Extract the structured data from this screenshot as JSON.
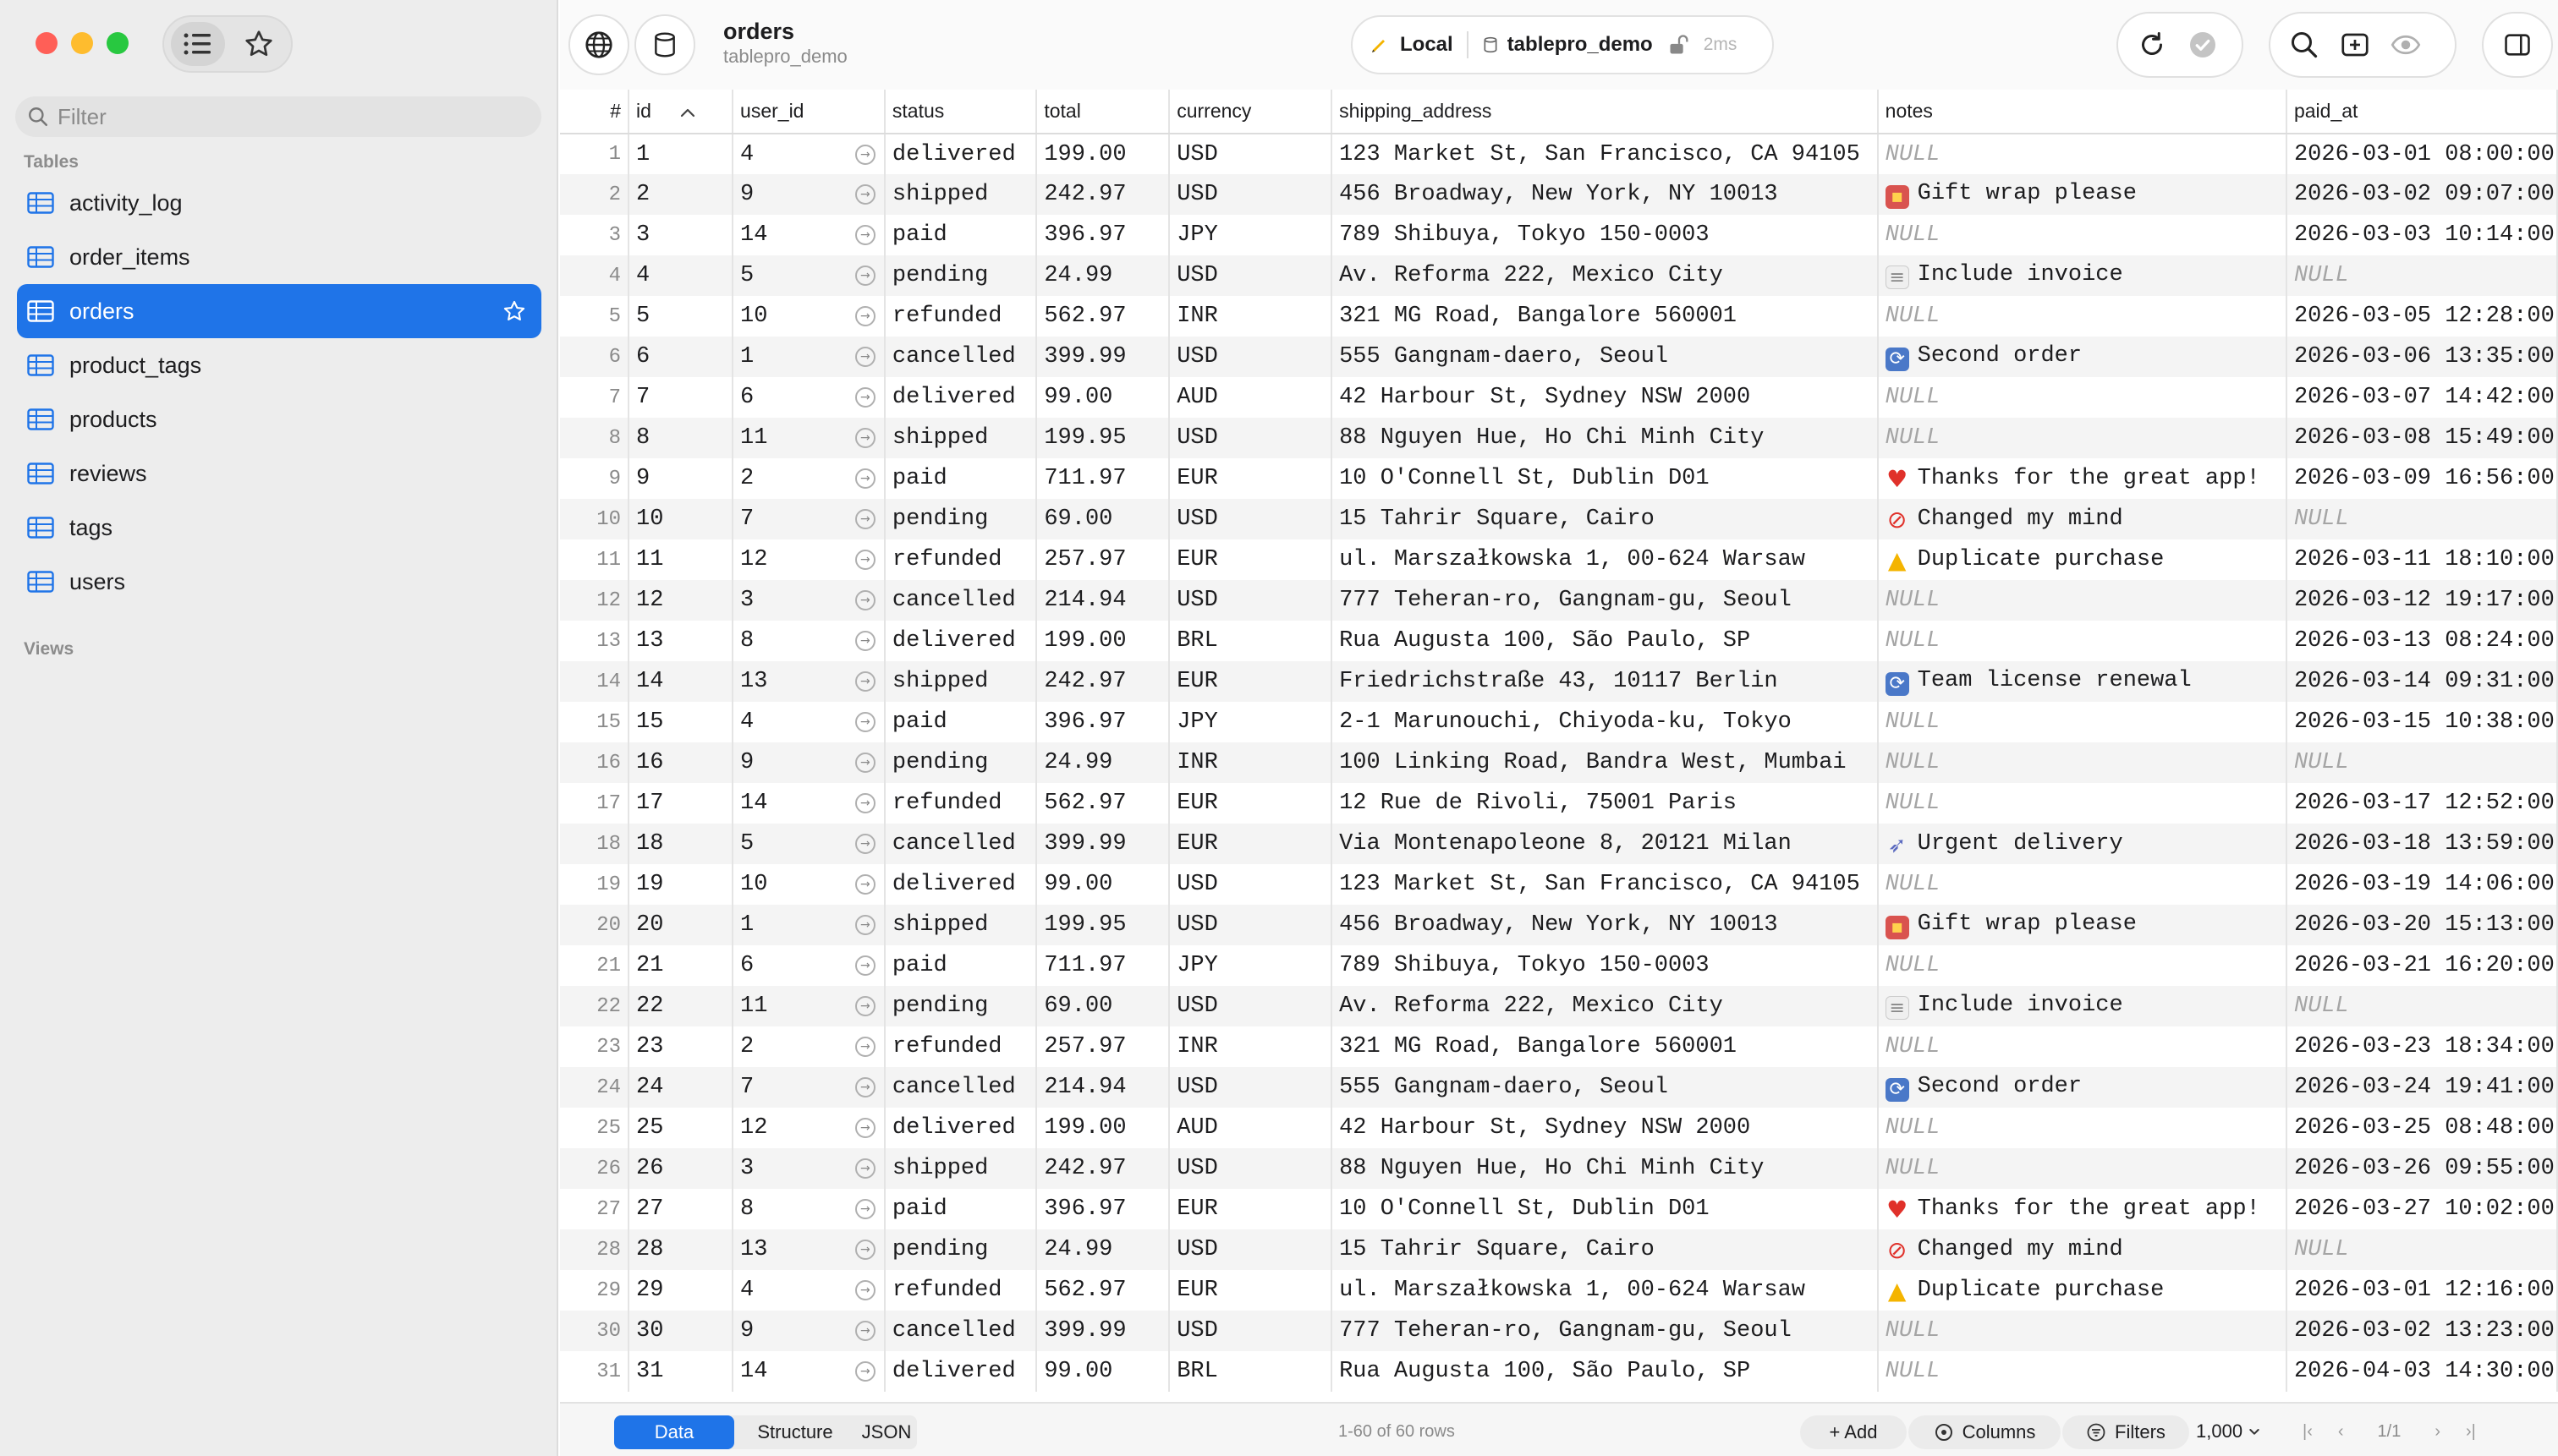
{
  "sidebar": {
    "filter_placeholder": "Filter",
    "tables_header": "Tables",
    "views_header": "Views",
    "tables": [
      {
        "label": "activity_log"
      },
      {
        "label": "order_items"
      },
      {
        "label": "orders",
        "active": true
      },
      {
        "label": "product_tags"
      },
      {
        "label": "products"
      },
      {
        "label": "reviews"
      },
      {
        "label": "tags"
      },
      {
        "label": "users"
      }
    ]
  },
  "toolbar": {
    "title": "orders",
    "subtitle": "tablepro_demo",
    "env": "Local",
    "database": "tablepro_demo",
    "latency": "2ms"
  },
  "grid": {
    "columns": [
      "#",
      "id",
      "user_id",
      "status",
      "total",
      "currency",
      "shipping_address",
      "notes",
      "paid_at"
    ],
    "sort_indicator": "^",
    "rows": [
      [
        "1",
        "1",
        "4",
        "delivered",
        "199.00",
        "USD",
        "123 Market St, San Francisco, CA 94105",
        "NULL",
        "2026-03-01 08:00:00"
      ],
      [
        "2",
        "2",
        "9",
        "shipped",
        "242.97",
        "USD",
        "456 Broadway, New York, NY 10013",
        "🎁 Gift wrap please",
        "2026-03-02 09:07:00"
      ],
      [
        "3",
        "3",
        "14",
        "paid",
        "396.97",
        "JPY",
        "789 Shibuya, Tokyo 150-0003",
        "NULL",
        "2026-03-03 10:14:00"
      ],
      [
        "4",
        "4",
        "5",
        "pending",
        "24.99",
        "USD",
        "Av. Reforma 222, Mexico City",
        "🧾 Include invoice",
        "NULL"
      ],
      [
        "5",
        "5",
        "10",
        "refunded",
        "562.97",
        "INR",
        "321 MG Road, Bangalore 560001",
        "NULL",
        "2026-03-05 12:28:00"
      ],
      [
        "6",
        "6",
        "1",
        "cancelled",
        "399.99",
        "USD",
        "555 Gangnam-daero, Seoul",
        "🔁 Second order",
        "2026-03-06 13:35:00"
      ],
      [
        "7",
        "7",
        "6",
        "delivered",
        "99.00",
        "AUD",
        "42 Harbour St, Sydney NSW 2000",
        "NULL",
        "2026-03-07 14:42:00"
      ],
      [
        "8",
        "8",
        "11",
        "shipped",
        "199.95",
        "USD",
        "88 Nguyen Hue, Ho Chi Minh City",
        "NULL",
        "2026-03-08 15:49:00"
      ],
      [
        "9",
        "9",
        "2",
        "paid",
        "711.97",
        "EUR",
        "10 O'Connell St, Dublin D01",
        "❤ Thanks for the great app!",
        "2026-03-09 16:56:00"
      ],
      [
        "10",
        "10",
        "7",
        "pending",
        "69.00",
        "USD",
        "15 Tahrir Square, Cairo",
        "🚫 Changed my mind",
        "NULL"
      ],
      [
        "11",
        "11",
        "12",
        "refunded",
        "257.97",
        "EUR",
        "ul. Marszałkowska 1, 00-624 Warsaw",
        "⚠ Duplicate purchase",
        "2026-03-11 18:10:00"
      ],
      [
        "12",
        "12",
        "3",
        "cancelled",
        "214.94",
        "USD",
        "777 Teheran-ro, Gangnam-gu, Seoul",
        "NULL",
        "2026-03-12 19:17:00"
      ],
      [
        "13",
        "13",
        "8",
        "delivered",
        "199.00",
        "BRL",
        "Rua Augusta 100, São Paulo, SP",
        "NULL",
        "2026-03-13 08:24:00"
      ],
      [
        "14",
        "14",
        "13",
        "shipped",
        "242.97",
        "EUR",
        "Friedrichstraße 43, 10117 Berlin",
        "🔁 Team license renewal",
        "2026-03-14 09:31:00"
      ],
      [
        "15",
        "15",
        "4",
        "paid",
        "396.97",
        "JPY",
        "2-1 Marunouchi, Chiyoda-ku, Tokyo",
        "NULL",
        "2026-03-15 10:38:00"
      ],
      [
        "16",
        "16",
        "9",
        "pending",
        "24.99",
        "INR",
        "100 Linking Road, Bandra West, Mumbai",
        "NULL",
        "NULL"
      ],
      [
        "17",
        "17",
        "14",
        "refunded",
        "562.97",
        "EUR",
        "12 Rue de Rivoli, 75001 Paris",
        "NULL",
        "2026-03-17 12:52:00"
      ],
      [
        "18",
        "18",
        "5",
        "cancelled",
        "399.99",
        "EUR",
        "Via Montenapoleone 8, 20121 Milan",
        "🚀 Urgent delivery",
        "2026-03-18 13:59:00"
      ],
      [
        "19",
        "19",
        "10",
        "delivered",
        "99.00",
        "USD",
        "123 Market St, San Francisco, CA 94105",
        "NULL",
        "2026-03-19 14:06:00"
      ],
      [
        "20",
        "20",
        "1",
        "shipped",
        "199.95",
        "USD",
        "456 Broadway, New York, NY 10013",
        "🎁 Gift wrap please",
        "2026-03-20 15:13:00"
      ],
      [
        "21",
        "21",
        "6",
        "paid",
        "711.97",
        "JPY",
        "789 Shibuya, Tokyo 150-0003",
        "NULL",
        "2026-03-21 16:20:00"
      ],
      [
        "22",
        "22",
        "11",
        "pending",
        "69.00",
        "USD",
        "Av. Reforma 222, Mexico City",
        "🧾 Include invoice",
        "NULL"
      ],
      [
        "23",
        "23",
        "2",
        "refunded",
        "257.97",
        "INR",
        "321 MG Road, Bangalore 560001",
        "NULL",
        "2026-03-23 18:34:00"
      ],
      [
        "24",
        "24",
        "7",
        "cancelled",
        "214.94",
        "USD",
        "555 Gangnam-daero, Seoul",
        "🔁 Second order",
        "2026-03-24 19:41:00"
      ],
      [
        "25",
        "25",
        "12",
        "delivered",
        "199.00",
        "AUD",
        "42 Harbour St, Sydney NSW 2000",
        "NULL",
        "2026-03-25 08:48:00"
      ],
      [
        "26",
        "26",
        "3",
        "shipped",
        "242.97",
        "USD",
        "88 Nguyen Hue, Ho Chi Minh City",
        "NULL",
        "2026-03-26 09:55:00"
      ],
      [
        "27",
        "27",
        "8",
        "paid",
        "396.97",
        "EUR",
        "10 O'Connell St, Dublin D01",
        "❤ Thanks for the great app!",
        "2026-03-27 10:02:00"
      ],
      [
        "28",
        "28",
        "13",
        "pending",
        "24.99",
        "USD",
        "15 Tahrir Square, Cairo",
        "🚫 Changed my mind",
        "NULL"
      ],
      [
        "29",
        "29",
        "4",
        "refunded",
        "562.97",
        "EUR",
        "ul. Marszałkowska 1, 00-624 Warsaw",
        "⚠ Duplicate purchase",
        "2026-03-01 12:16:00"
      ],
      [
        "30",
        "30",
        "9",
        "cancelled",
        "399.99",
        "USD",
        "777 Teheran-ro, Gangnam-gu, Seoul",
        "NULL",
        "2026-03-02 13:23:00"
      ],
      [
        "31",
        "31",
        "14",
        "delivered",
        "99.00",
        "BRL",
        "Rua Augusta 100, São Paulo, SP",
        "NULL",
        "2026-04-03 14:30:00"
      ]
    ]
  },
  "bottom": {
    "tabs": [
      {
        "label": "Data",
        "active": true
      },
      {
        "label": "Structure"
      },
      {
        "label": "JSON"
      }
    ],
    "row_count": "1-60 of 60 rows",
    "add_label": "+ Add",
    "columns_label": "Columns",
    "filters_label": "Filters",
    "page_size": "1,000",
    "page_indicator": "1/1"
  },
  "colors": {
    "accent": "#1f74e8",
    "null_text": "#a5a5a5",
    "traffic_red": "#ff5f57",
    "traffic_yellow": "#febc2e",
    "traffic_green": "#28c840"
  }
}
